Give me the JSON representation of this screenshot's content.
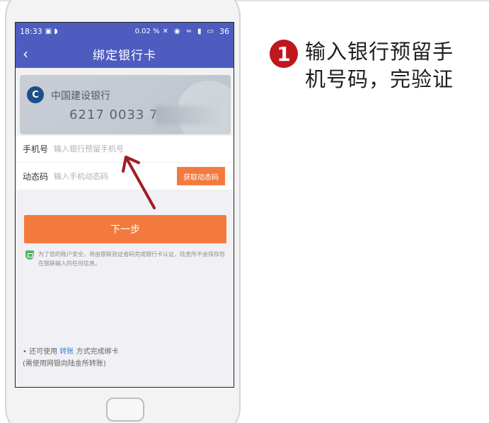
{
  "status_bar": {
    "time": "18:33",
    "left_icons": "▣ ◗",
    "data_rate": "0.02",
    "battery": "36"
  },
  "nav": {
    "back_icon": "‹",
    "title": "绑定银行卡"
  },
  "card": {
    "bank_name": "中国建设银行",
    "card_number": "6217 0033 7"
  },
  "form": {
    "phone_label": "手机号",
    "phone_placeholder": "输入银行预留手机号",
    "code_label": "动态码",
    "code_placeholder": "输入手机动态码",
    "get_code_button": "获取动态码"
  },
  "next_button": "下一步",
  "security_notice": "为了您的账户安全，将由银联验证省码完成银行卡认证，陆金所不会保存您在银联输入的任何信息。",
  "bottom_hint": {
    "line1_prefix": "• 还可使用 ",
    "line1_link": "转账",
    "line1_suffix": " 方式完成绑卡",
    "line2": "(需使用网银向陆金所转账)"
  },
  "annotation": {
    "step_number": "1",
    "text": "输入银行预留手机号码，完验证"
  },
  "colors": {
    "header": "#4e5cc0",
    "accent_orange": "#f37a3f",
    "badge_red": "#c0161d",
    "arrow_red": "#a01c24"
  }
}
